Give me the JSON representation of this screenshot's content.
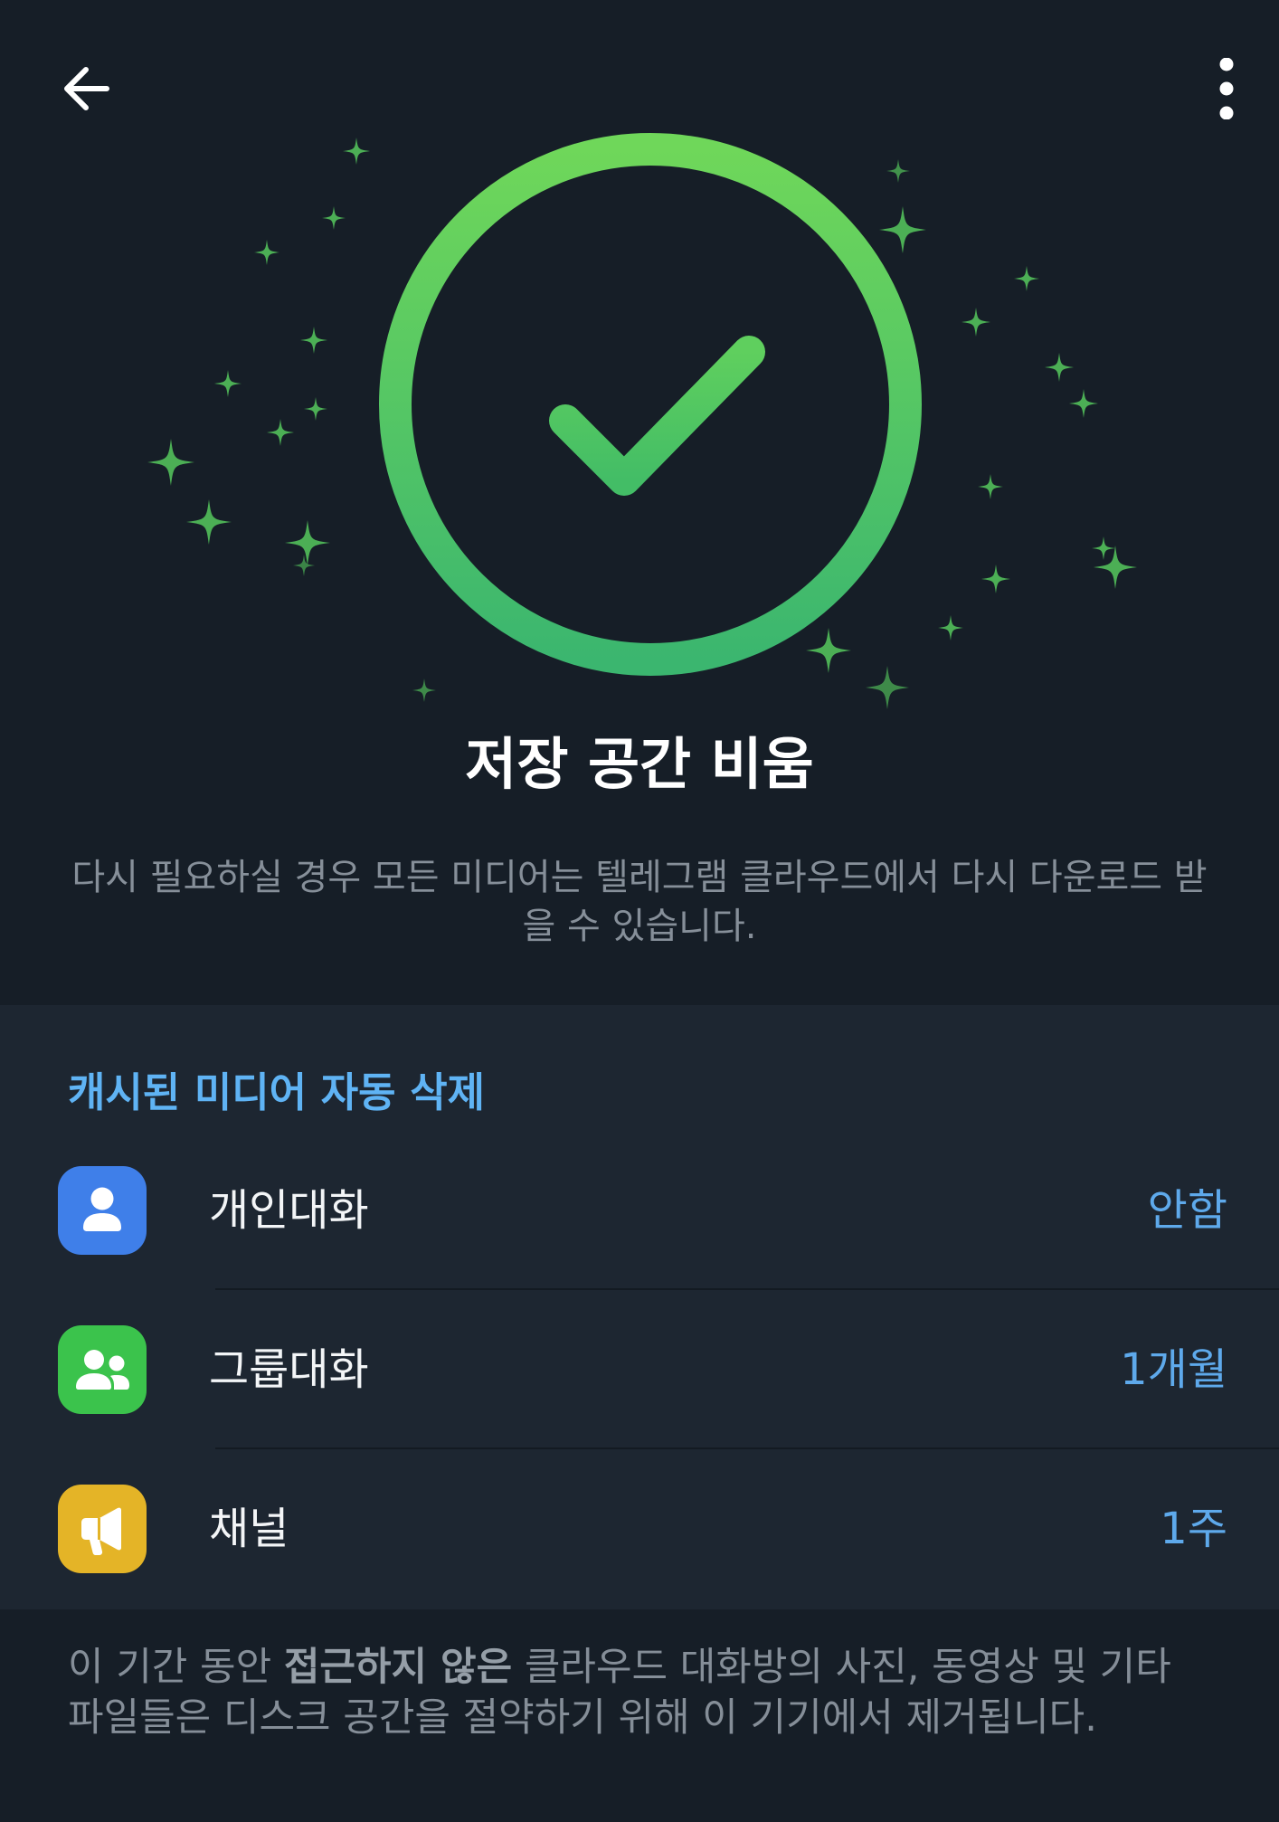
{
  "header": {
    "back_icon": "arrow-left-icon",
    "menu_icon": "more-vertical-icon"
  },
  "hero": {
    "icon": "check-circle-icon",
    "decoration_icon": "sparkle-icon",
    "title": "저장 공간 비움",
    "subtitle": "다시 필요하실 경우 모든 미디어는 텔레그램 클라우드에서 다시 다운로드 받을 수 있습니다."
  },
  "auto_delete": {
    "heading": "캐시된 미디어 자동 삭제",
    "rows": [
      {
        "label": "개인대화",
        "value": "안함",
        "icon": "person-icon",
        "icon_color": "#3f7fe9"
      },
      {
        "label": "그룹대화",
        "value": "1개월",
        "icon": "group-icon",
        "icon_color": "#3bc34c"
      },
      {
        "label": "채널",
        "value": "1주",
        "icon": "megaphone-icon",
        "icon_color": "#e4b427"
      }
    ]
  },
  "footer": {
    "text_before": "이 기간 동안 ",
    "text_bold": "접근하지 않은",
    "text_after": " 클라우드 대화방의 사진, 동영상 및 기타 파일들은 디스크 공간을 절약하기 위해 이 기기에서 제거됩니다."
  },
  "colors": {
    "background": "#161e27",
    "section_background": "#1d2631",
    "accent_blue": "#5fb3f4",
    "value_blue": "#5ea9eb",
    "success_green": "#5fcf5e",
    "muted_text": "#868f99"
  }
}
